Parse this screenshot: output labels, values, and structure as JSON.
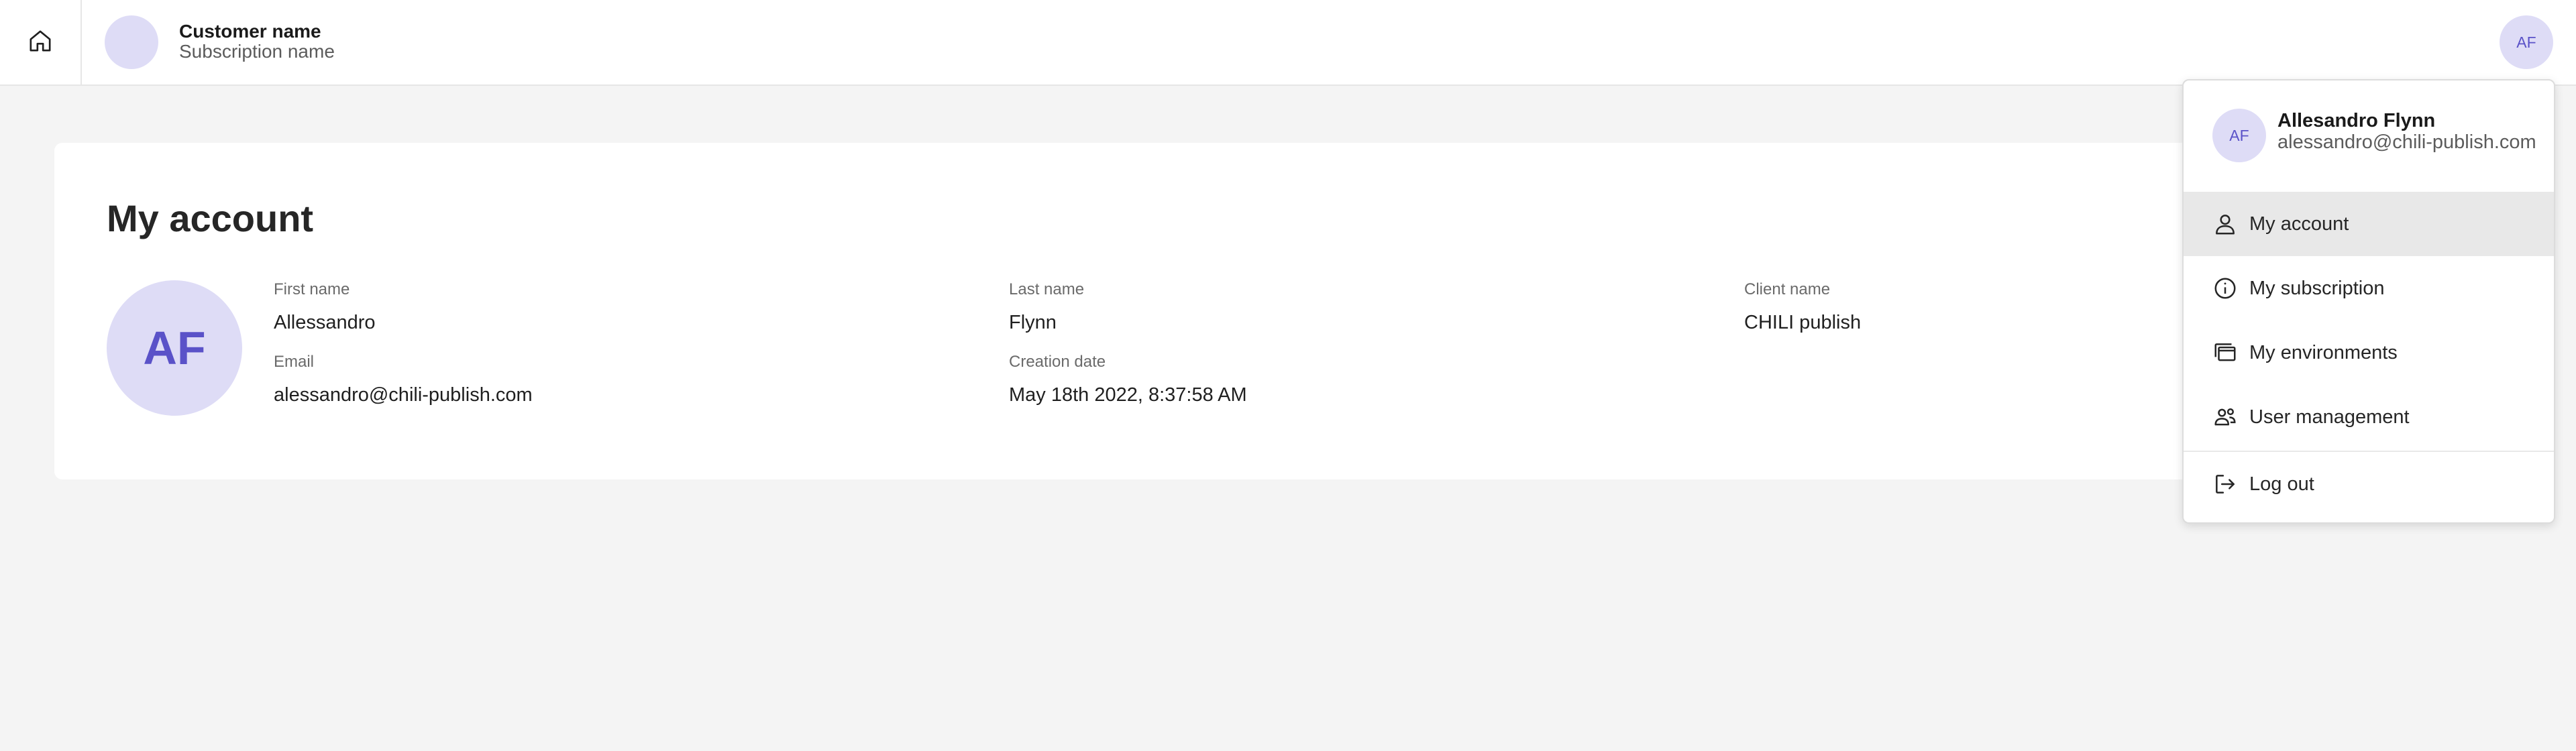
{
  "topbar": {
    "customer_name": "Customer name",
    "subscription_name": "Subscription name",
    "user_initials": "AF"
  },
  "account": {
    "title": "My account",
    "avatar_initials": "AF",
    "fields": {
      "first_name": {
        "label": "First name",
        "value": "Allessandro"
      },
      "last_name": {
        "label": "Last name",
        "value": "Flynn"
      },
      "client_name": {
        "label": "Client name",
        "value": "CHILI publish"
      },
      "email": {
        "label": "Email",
        "value": "alessandro@chili-publish.com"
      },
      "creation_date": {
        "label": "Creation date",
        "value": "May 18th 2022, 8:37:58 AM"
      }
    }
  },
  "menu": {
    "avatar_initials": "AF",
    "user_name": "Allesandro Flynn",
    "user_email": "alessandro@chili-publish.com",
    "items": [
      {
        "label": "My account",
        "icon": "person-icon",
        "active": true
      },
      {
        "label": "My subscription",
        "icon": "info-icon",
        "active": false
      },
      {
        "label": "My environments",
        "icon": "environments-icon",
        "active": false
      },
      {
        "label": "User management",
        "icon": "users-icon",
        "active": false
      },
      {
        "label": "Log out",
        "icon": "logout-icon",
        "active": false
      }
    ]
  },
  "colors": {
    "background": "#f4f4f4",
    "card": "#ffffff",
    "avatar_bg": "#dedcf6",
    "avatar_text": "#5a52c8",
    "active_item": "#e8e8e8"
  }
}
